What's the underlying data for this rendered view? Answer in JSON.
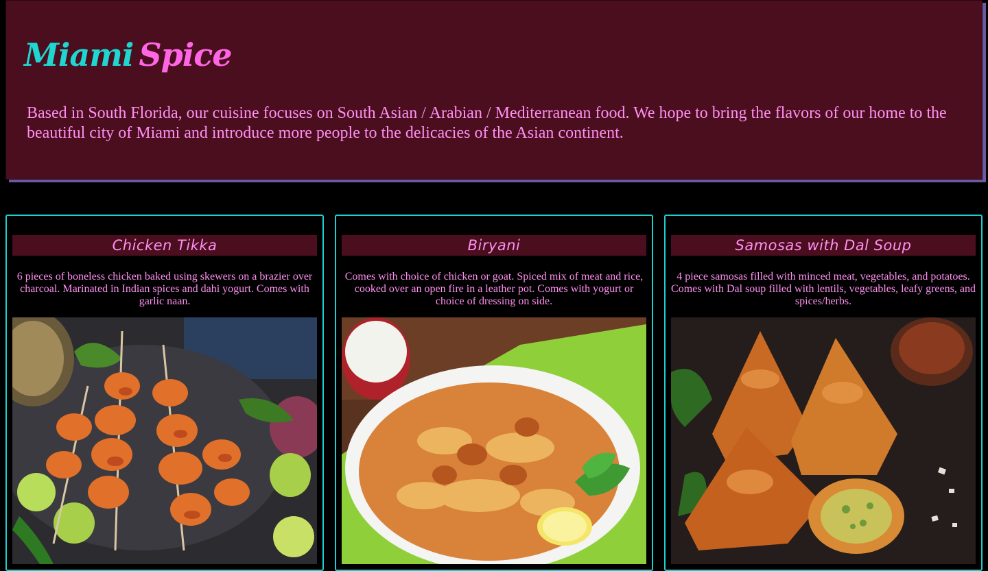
{
  "header": {
    "brand_part1": "Miami",
    "brand_part2": "Spice",
    "description": "Based in South Florida, our cuisine focuses on South Asian / Arabian / Mediterranean food. We hope to bring the flavors of our home to the beautiful city of Miami and introduce more people to the delicacies of the Asian continent."
  },
  "colors": {
    "header_bg": "#4a0e1e",
    "accent_teal": "#1fd6d0",
    "accent_pink": "#ff66e6",
    "text_pink": "#ff8ff0",
    "header_shadow": "#6a5aa0",
    "page_bg": "#000000"
  },
  "menu": {
    "items": [
      {
        "title": "Chicken Tikka",
        "description": "6 pieces of boneless chicken baked using skewers on a brazier over charcoal. Marinated in Indian spices and dahi yogurt. Comes with garlic naan."
      },
      {
        "title": "Biryani",
        "description": "Comes with choice of chicken or goat. Spiced mix of meat and rice, cooked over an open fire in a leather pot. Comes with yogurt or choice of dressing on side."
      },
      {
        "title": "Samosas with Dal Soup",
        "description": "4 piece samosas filled with minced meat, vegetables, and potatoes. Comes with Dal soup filled with lentils, vegetables, leafy greens, and spices/herbs."
      }
    ]
  }
}
